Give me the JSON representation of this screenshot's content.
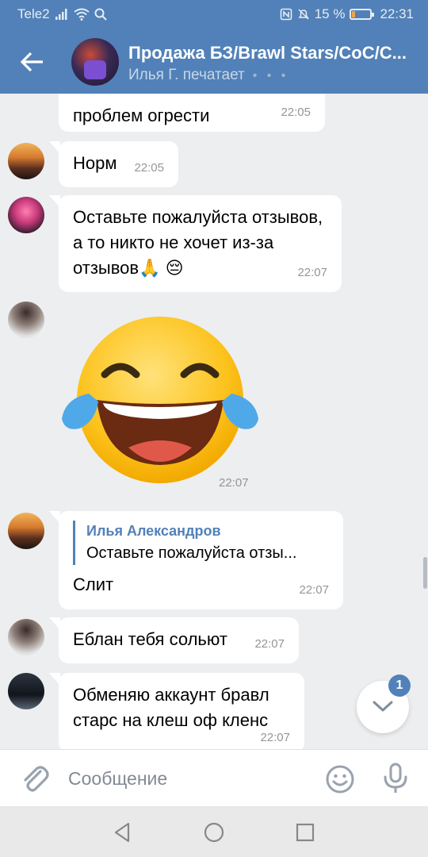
{
  "status_bar": {
    "carrier": "Tele2",
    "battery_percent": "15 %",
    "battery_level": 0.15,
    "time": "22:31",
    "icons": [
      "signal-icon",
      "wifi-icon",
      "search-icon",
      "nfc-icon",
      "mute-icon",
      "battery-icon"
    ]
  },
  "header": {
    "title": "Продажа БЗ/Brawl Stars/CoC/C...",
    "status": "Илья Г. печатает",
    "typing_dots": "• • •"
  },
  "messages": [
    {
      "text": "проблем огрести",
      "time": "22:05"
    },
    {
      "text": "Норм",
      "time": "22:05"
    },
    {
      "text": "Оставьте пожалуйста отзывов, а то никто не хочет из-за отзывов🙏 😔",
      "time": "22:07"
    },
    {
      "sticker": "laughing-tears-emoji",
      "time": "22:07"
    },
    {
      "reply_name": "Илья Александров",
      "reply_text": "Оставьте пожалуйста отзы...",
      "text": "Слит",
      "time": "22:07"
    },
    {
      "text": "Еблан тебя сольют",
      "time": "22:07"
    },
    {
      "text": "Обменяю аккаунт бравл старс на клеш оф кленс",
      "time": "22:07"
    }
  ],
  "unread_count": "1",
  "composer": {
    "placeholder": "Сообщение",
    "value": ""
  },
  "colors": {
    "accent": "#5181b8",
    "background": "#edeef0",
    "bubble": "#ffffff"
  }
}
